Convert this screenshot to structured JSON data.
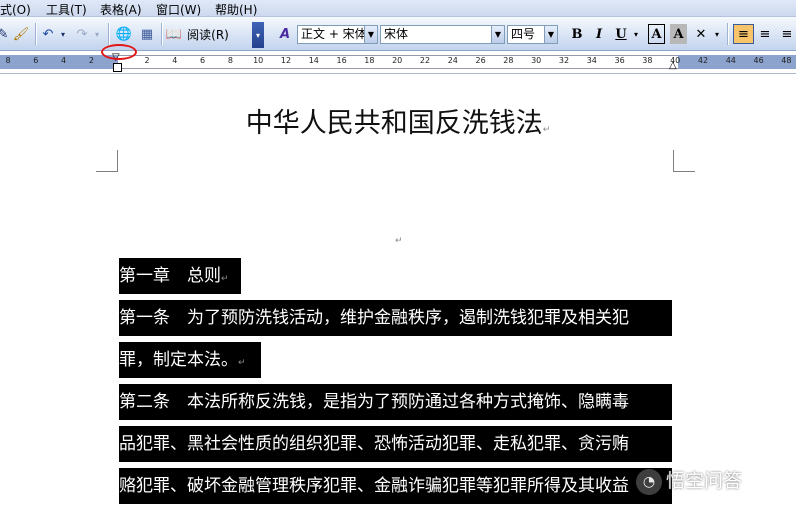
{
  "menu": {
    "items": [
      {
        "label": "式(O)"
      },
      {
        "label": "工具(T)"
      },
      {
        "label": "表格(A)"
      },
      {
        "label": "窗口(W)"
      },
      {
        "label": "帮助(H)"
      }
    ]
  },
  "toolbar": {
    "read_label": "阅读(R)",
    "style_value": "正文 + 宋体",
    "font_value": "宋体",
    "size_value": "四号",
    "bold_label": "B",
    "italic_label": "I",
    "underline_label": "U",
    "charborder_label": "A",
    "charshade_label": "A"
  },
  "ruler": {
    "ticks": [
      "8",
      "6",
      "4",
      "2",
      "2",
      "4",
      "6",
      "8",
      "10",
      "12",
      "14",
      "16",
      "18",
      "20",
      "22",
      "24",
      "26",
      "28",
      "30",
      "32",
      "34",
      "36",
      "38",
      "40",
      "42",
      "44",
      "46",
      "48"
    ]
  },
  "document": {
    "title": "中华人民共和国反洗钱法",
    "lines": [
      "第一章　总则",
      "第一条　为了预防洗钱活动，维护金融秩序，遏制洗钱犯罪及相关犯",
      "罪，制定本法。",
      "第二条　本法所称反洗钱，是指为了预防通过各种方式掩饰、隐瞒毒",
      "品犯罪、黑社会性质的组织犯罪、恐怖活动犯罪、走私犯罪、贪污贿",
      "赂犯罪、破坏金融管理秩序犯罪、金融诈骗犯罪等犯罪所得及其收益"
    ],
    "para_mark": "↵"
  },
  "watermark": {
    "text": "悟空问答"
  }
}
